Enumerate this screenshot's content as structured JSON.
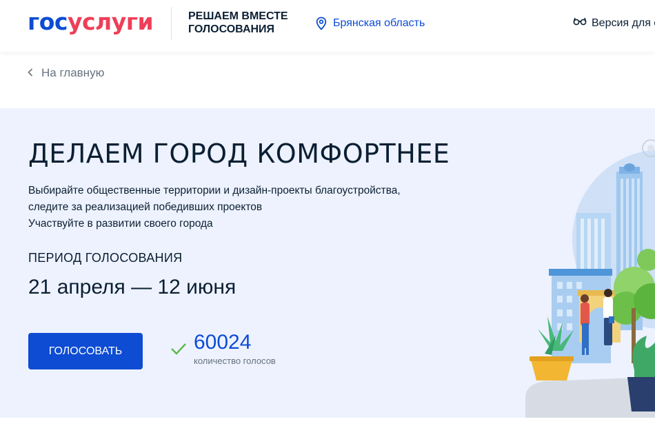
{
  "header": {
    "logo_part1": "гос",
    "logo_part2": "услуги",
    "project_name": "РЕШАЕМ ВМЕСТЕ\nГОЛОСОВАНИЯ",
    "region": "Брянская область",
    "accessibility_label": "Версия для с"
  },
  "breadcrumb": {
    "label": "На главную"
  },
  "hero": {
    "title": "ДЕЛАЕМ ГОРОД КОМФОРТНЕЕ",
    "desc_line1": "Выбирайте общественные территории и дизайн-проекты благоустройства,",
    "desc_line2": "следите за реализацией победивших проектов",
    "desc_line3": "Участвуйте в развитии своего города",
    "period_label": "ПЕРИОД ГОЛОСОВАНИЯ",
    "period_dates": "21 апреля — 12 июня",
    "vote_button": "ГОЛОСОВАТЬ",
    "votes_count": "60024",
    "votes_label": "количество голосов"
  },
  "colors": {
    "primary": "#0d4cd3",
    "logo_red": "#ee3f58",
    "hero_bg": "#edf2fe",
    "check_green": "#5bb84c"
  },
  "icons": [
    "location-pin-icon",
    "glasses-icon",
    "chevron-left-icon",
    "checkmark-icon"
  ]
}
